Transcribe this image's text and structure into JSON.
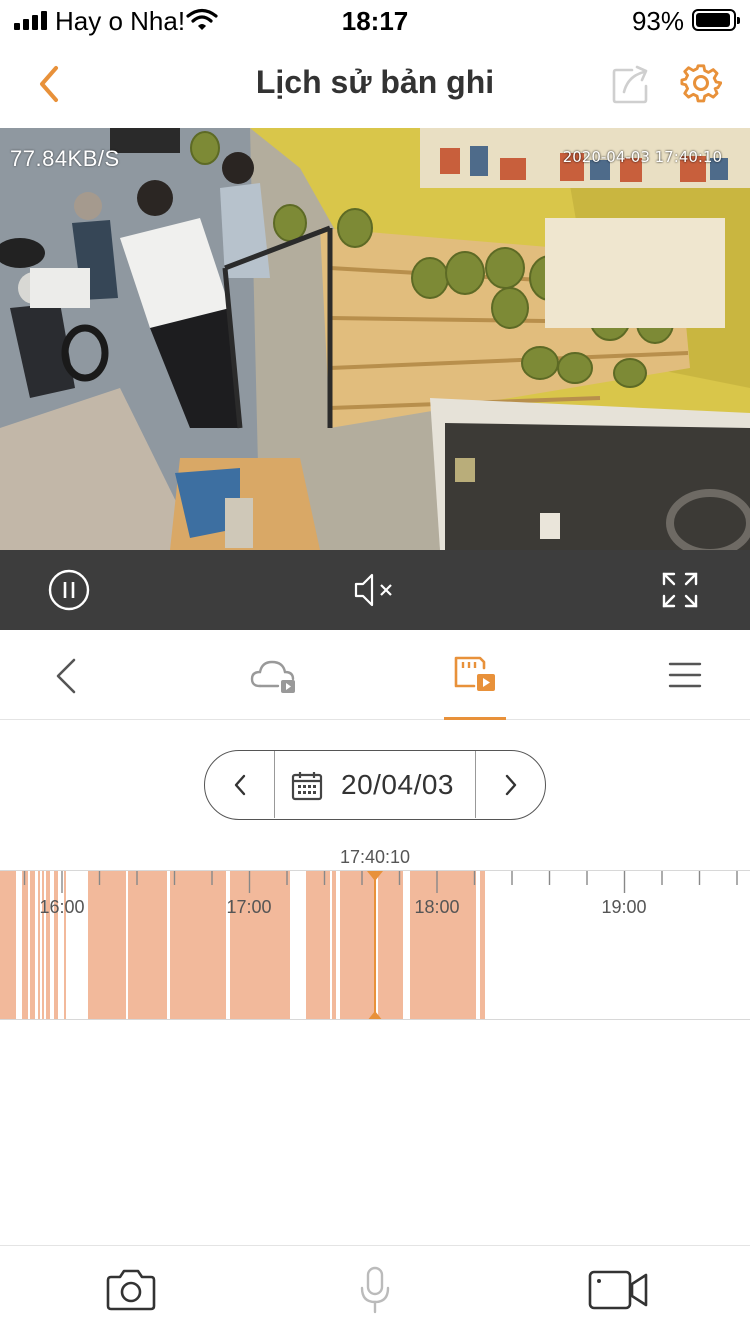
{
  "status_bar": {
    "carrier": "Hay o Nha!",
    "time": "18:17",
    "battery": "93%",
    "battery_level": 0.93
  },
  "header": {
    "title": "Lịch sử bản ghi",
    "accent_color": "#e8913a"
  },
  "video": {
    "bitrate": "77.84KB/S",
    "timestamp": "2020-04-03 17:40:10"
  },
  "controls": {
    "icons": [
      "pause-icon",
      "speaker-muted-icon",
      "fullscreen-icon"
    ]
  },
  "tabs": {
    "icons": [
      "back-chevron-icon",
      "cloud-playback-icon",
      "sd-card-playback-icon",
      "menu-icon"
    ],
    "active": "sd-card-playback-icon"
  },
  "date_picker": {
    "date": "20/04/03"
  },
  "timeline": {
    "cursor_time": "17:40:10",
    "hour_labels": [
      "16:00",
      "17:00",
      "18:00",
      "19:00"
    ],
    "recording_color": "#f2b99b",
    "cursor_color": "#e8913a"
  },
  "bottom_bar": {
    "icons": [
      "camera-snapshot-icon",
      "microphone-icon",
      "video-record-icon"
    ]
  }
}
